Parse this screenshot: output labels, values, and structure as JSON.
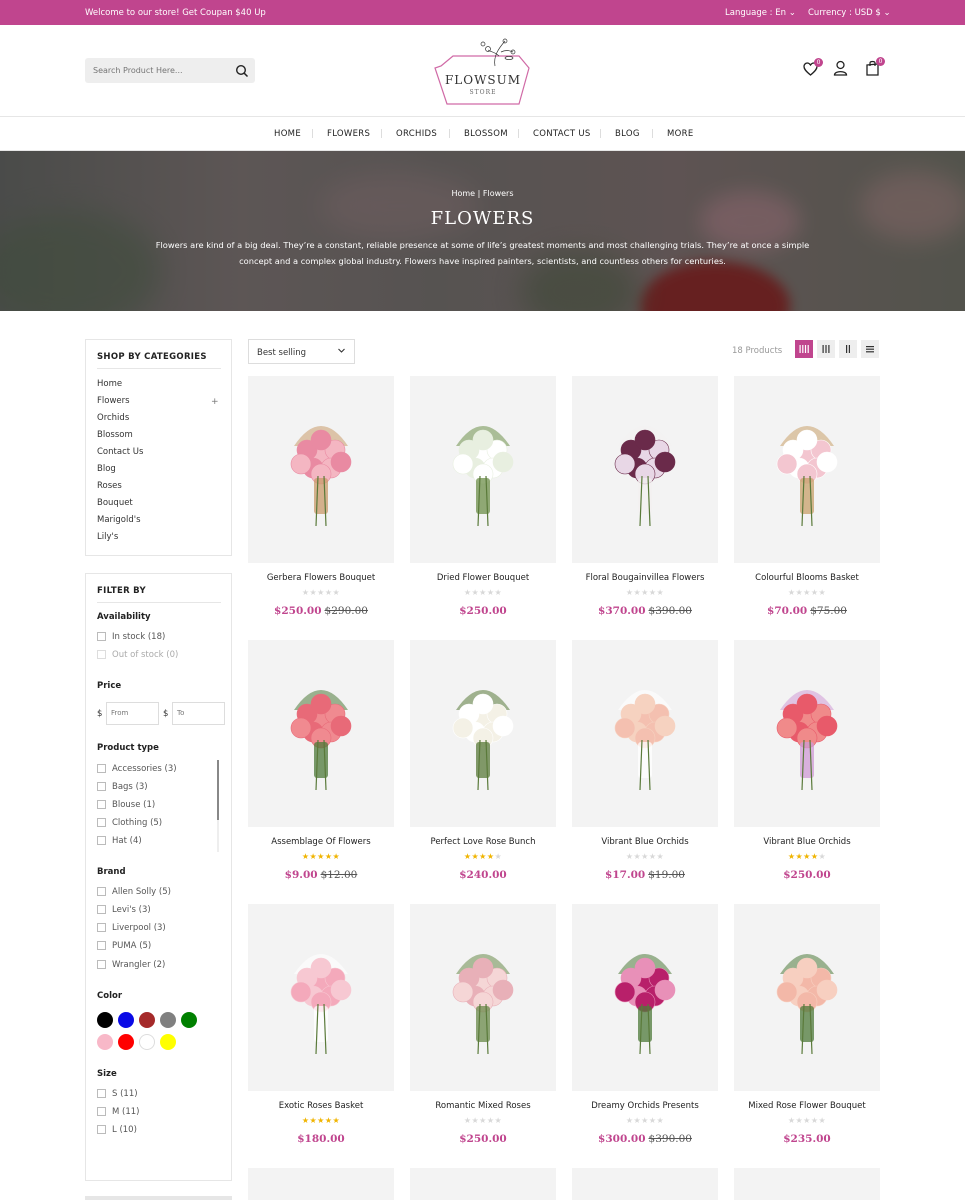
{
  "topbar": {
    "welcome": "Welcome to our store! Get Coupan $40 Up",
    "language": "Language : En",
    "currency": "Currency : USD $"
  },
  "search": {
    "placeholder": "Search Product Here..."
  },
  "logo": {
    "name": "FLOWSUM",
    "sub": "STORE"
  },
  "header_icons": {
    "wishlist_count": "0",
    "cart_count": "0"
  },
  "nav": [
    "HOME",
    "FLOWERS",
    "ORCHIDS",
    "BLOSSOM",
    "CONTACT US",
    "BLOG",
    "MORE"
  ],
  "hero": {
    "breadcrumb": "Home |  Flowers",
    "title": "FLOWERS",
    "description": "Flowers are kind of a big deal. They’re a constant, reliable presence at some of life’s greatest moments and most challenging trials. They’re at once a simple concept and a complex global industry. Flowers have inspired painters, scientists, and countless others for centuries."
  },
  "categories": {
    "title": "SHOP BY CATEGORIES",
    "items": [
      "Home",
      "Flowers",
      "Orchids",
      "Blossom",
      "Contact Us",
      "Blog",
      "Roses",
      "Bouquet",
      "Marigold's",
      "Lily's"
    ]
  },
  "filter": {
    "title": "FILTER BY",
    "availability": {
      "label": "Availability",
      "options": [
        "In stock (18)",
        "Out of stock (0)"
      ]
    },
    "price": {
      "label": "Price",
      "currency": "$",
      "from": "From",
      "to": "To"
    },
    "product_type": {
      "label": "Product type",
      "options": [
        "Accessories (3)",
        "Bags (3)",
        "Blouse (1)",
        "Clothing (5)",
        "Hat (4)"
      ]
    },
    "brand": {
      "label": "Brand",
      "options": [
        "Allen Solly (5)",
        "Levi's (3)",
        "Liverpool (3)",
        "PUMA (5)",
        "Wrangler (2)"
      ]
    },
    "color": {
      "label": "Color",
      "swatches": [
        "#000000",
        "#0a0ae6",
        "#a52a2a",
        "#808080",
        "#008000",
        "#f8b8c8",
        "#ff0000",
        "#ffffff",
        "#ffff00"
      ]
    },
    "size": {
      "label": "Size",
      "options": [
        "S (11)",
        "M (11)",
        "L (10)"
      ]
    }
  },
  "toolbar": {
    "sort": "Best selling",
    "count": "18 Products"
  },
  "products": [
    {
      "name": "Gerbera Flowers Bouquet",
      "rating": 0,
      "price": "$250.00",
      "old": "$290.00"
    },
    {
      "name": "Dried Flower Bouquet",
      "rating": 0,
      "price": "$250.00",
      "old": ""
    },
    {
      "name": "Floral Bougainvillea Flowers",
      "rating": 0,
      "price": "$370.00",
      "old": "$390.00"
    },
    {
      "name": "Colourful Blooms Basket",
      "rating": 0,
      "price": "$70.00",
      "old": "$75.00"
    },
    {
      "name": "Assemblage Of Flowers",
      "rating": 5,
      "price": "$9.00",
      "old": "$12.00"
    },
    {
      "name": "Perfect Love Rose Bunch",
      "rating": 4,
      "price": "$240.00",
      "old": ""
    },
    {
      "name": "Vibrant Blue Orchids",
      "rating": 0,
      "price": "$17.00",
      "old": "$19.00"
    },
    {
      "name": "Vibrant Blue Orchids",
      "rating": 4,
      "price": "$250.00",
      "old": ""
    },
    {
      "name": "Exotic Roses Basket",
      "rating": 5,
      "price": "$180.00",
      "old": ""
    },
    {
      "name": "Romantic Mixed Roses",
      "rating": 0,
      "price": "$250.00",
      "old": ""
    },
    {
      "name": "Dreamy Orchids Presents",
      "rating": 0,
      "price": "$300.00",
      "old": "$390.00"
    },
    {
      "name": "Mixed Rose Flower Bouquet",
      "rating": 0,
      "price": "$235.00",
      "old": ""
    }
  ]
}
